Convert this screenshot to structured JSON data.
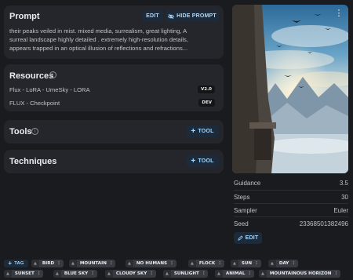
{
  "prompt": {
    "title": "Prompt",
    "edit_label": "EDIT",
    "hide_label": "HIDE PROMPT",
    "line1": "their peaks veiled in mist. mixed media, surrealism, great lighting, A",
    "line2": "surreal landscape highly detailed . extremely high-resolution details,",
    "line3": "appears trapped in an optical illusion of reflections and refractions..."
  },
  "resources": {
    "title": "Resources",
    "items": [
      {
        "name": "Flux - LoRA - UmeSky - LORA",
        "badge": "V2.0"
      },
      {
        "name": "FLUX - Checkpoint",
        "badge": "DEV"
      }
    ]
  },
  "tools": {
    "title": "Tools",
    "add_label": "TOOL"
  },
  "techniques": {
    "title": "Techniques",
    "add_label": "TOOL"
  },
  "meta": {
    "guidance": {
      "key": "Guidance",
      "value": "3.5"
    },
    "steps": {
      "key": "Steps",
      "value": "30"
    },
    "sampler": {
      "key": "Sampler",
      "value": "Euler"
    },
    "seed": {
      "key": "Seed",
      "value": "23368501382496"
    },
    "edit_label": "EDIT"
  },
  "tags": {
    "add_label": "TAG",
    "row1": [
      "BIRD",
      "MOUNTAIN",
      "NO HUMANS",
      "FLOCK",
      "SUN",
      "DAY"
    ],
    "row2": [
      "SUNSET",
      "BLUE SKY",
      "CLOUDY SKY",
      "SUNLIGHT",
      "ANIMAL",
      "MOUNTAINOUS HORIZON"
    ]
  },
  "colors": {
    "background": "#1a1b1e",
    "card": "#25262b",
    "accent": "#a5d8ff"
  },
  "icons": {
    "hide": "eye-off-icon",
    "info": "info-icon",
    "plus": "plus-icon",
    "pencil": "pencil-icon",
    "menu": "kebab-menu-icon",
    "vote": "arrow-up-icon"
  }
}
